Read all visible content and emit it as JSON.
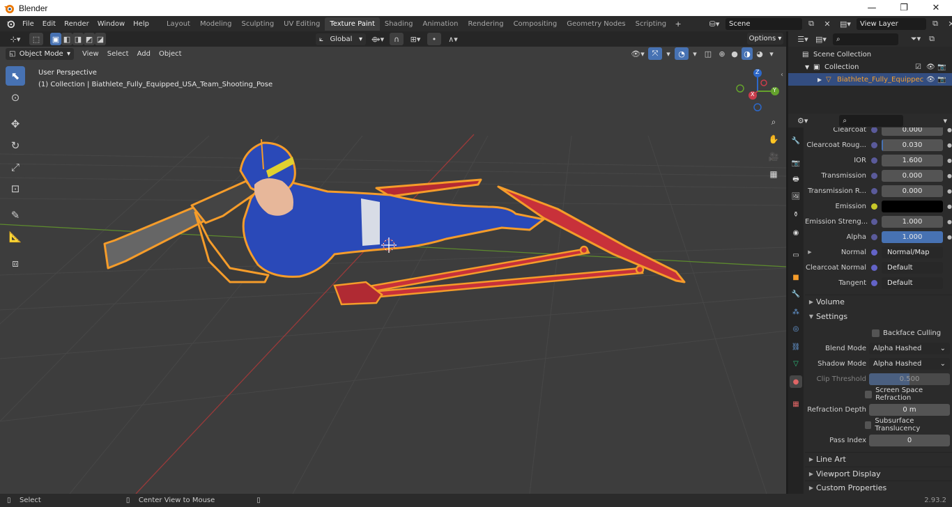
{
  "window": {
    "title": "Blender",
    "minimize": "—",
    "maximize": "❐",
    "close": "✕"
  },
  "menu": [
    "File",
    "Edit",
    "Render",
    "Window",
    "Help"
  ],
  "workspaces": [
    "Layout",
    "Modeling",
    "Sculpting",
    "UV Editing",
    "Texture Paint",
    "Shading",
    "Animation",
    "Rendering",
    "Compositing",
    "Geometry Nodes",
    "Scripting"
  ],
  "active_workspace": "Texture Paint",
  "add_workspace": "+",
  "scene": {
    "name": "Scene",
    "view_layer": "View Layer"
  },
  "viewport": {
    "transform_orientation": "Global",
    "options_label": "Options",
    "mode": "Object Mode",
    "menus": [
      "View",
      "Select",
      "Add",
      "Object"
    ],
    "perspective_label": "User Perspective",
    "collection_label": "(1) Collection | Biathlete_Fully_Equipped_USA_Team_Shooting_Pose",
    "gizmo_axes": {
      "x": "X",
      "y": "Y",
      "z": "Z"
    }
  },
  "outliner": {
    "rows": [
      {
        "label": "Scene Collection"
      },
      {
        "label": "Collection"
      },
      {
        "label": "Biathlete_Fully_Equippec"
      }
    ]
  },
  "properties": {
    "rows": [
      {
        "label": "Clearcoat",
        "value": "0.000",
        "dot": "#5a5a9a",
        "style": "num"
      },
      {
        "label": "Clearcoat Roug...",
        "value": "0.030",
        "dot": "#5a5a9a",
        "style": "num"
      },
      {
        "label": "IOR",
        "value": "1.600",
        "dot": "#5a5a9a",
        "style": "num"
      },
      {
        "label": "Transmission",
        "value": "0.000",
        "dot": "#5a5a9a",
        "style": "num"
      },
      {
        "label": "Transmission R...",
        "value": "0.000",
        "dot": "#5a5a9a",
        "style": "num"
      },
      {
        "label": "Emission",
        "value": "",
        "dot": "#c7c729",
        "style": "color"
      },
      {
        "label": "Emission Streng...",
        "value": "1.000",
        "dot": "#5a5a9a",
        "style": "num"
      },
      {
        "label": "Alpha",
        "value": "1.000",
        "dot": "#5a5a9a",
        "style": "blue"
      },
      {
        "label": "Normal",
        "value": "Normal/Map",
        "dot": "#6363c7",
        "style": "link"
      },
      {
        "label": "Clearcoat Normal",
        "value": "Default",
        "dot": "#6363c7",
        "style": "link"
      },
      {
        "label": "Tangent",
        "value": "Default",
        "dot": "#6363c7",
        "style": "link"
      }
    ],
    "volume_label": "Volume",
    "settings_label": "Settings",
    "backface_culling": "Backface Culling",
    "blend_mode_label": "Blend Mode",
    "blend_mode_value": "Alpha Hashed",
    "shadow_mode_label": "Shadow Mode",
    "shadow_mode_value": "Alpha Hashed",
    "clip_threshold_label": "Clip Threshold",
    "clip_threshold_value": "0.500",
    "ssr_label": "Screen Space Refraction",
    "refraction_depth_label": "Refraction Depth",
    "refraction_depth_value": "0 m",
    "sss_label": "Subsurface Translucency",
    "pass_index_label": "Pass Index",
    "pass_index_value": "0",
    "line_art_label": "Line Art",
    "viewport_display_label": "Viewport Display",
    "custom_properties_label": "Custom Properties"
  },
  "statusbar": {
    "select": "Select",
    "center_view": "Center View to Mouse",
    "version": "2.93.2"
  },
  "colors": {
    "accent": "#4772b3",
    "selection_outline": "#f59c2a",
    "suit_blue": "#2a49b8",
    "ski_red": "#c8313a"
  }
}
